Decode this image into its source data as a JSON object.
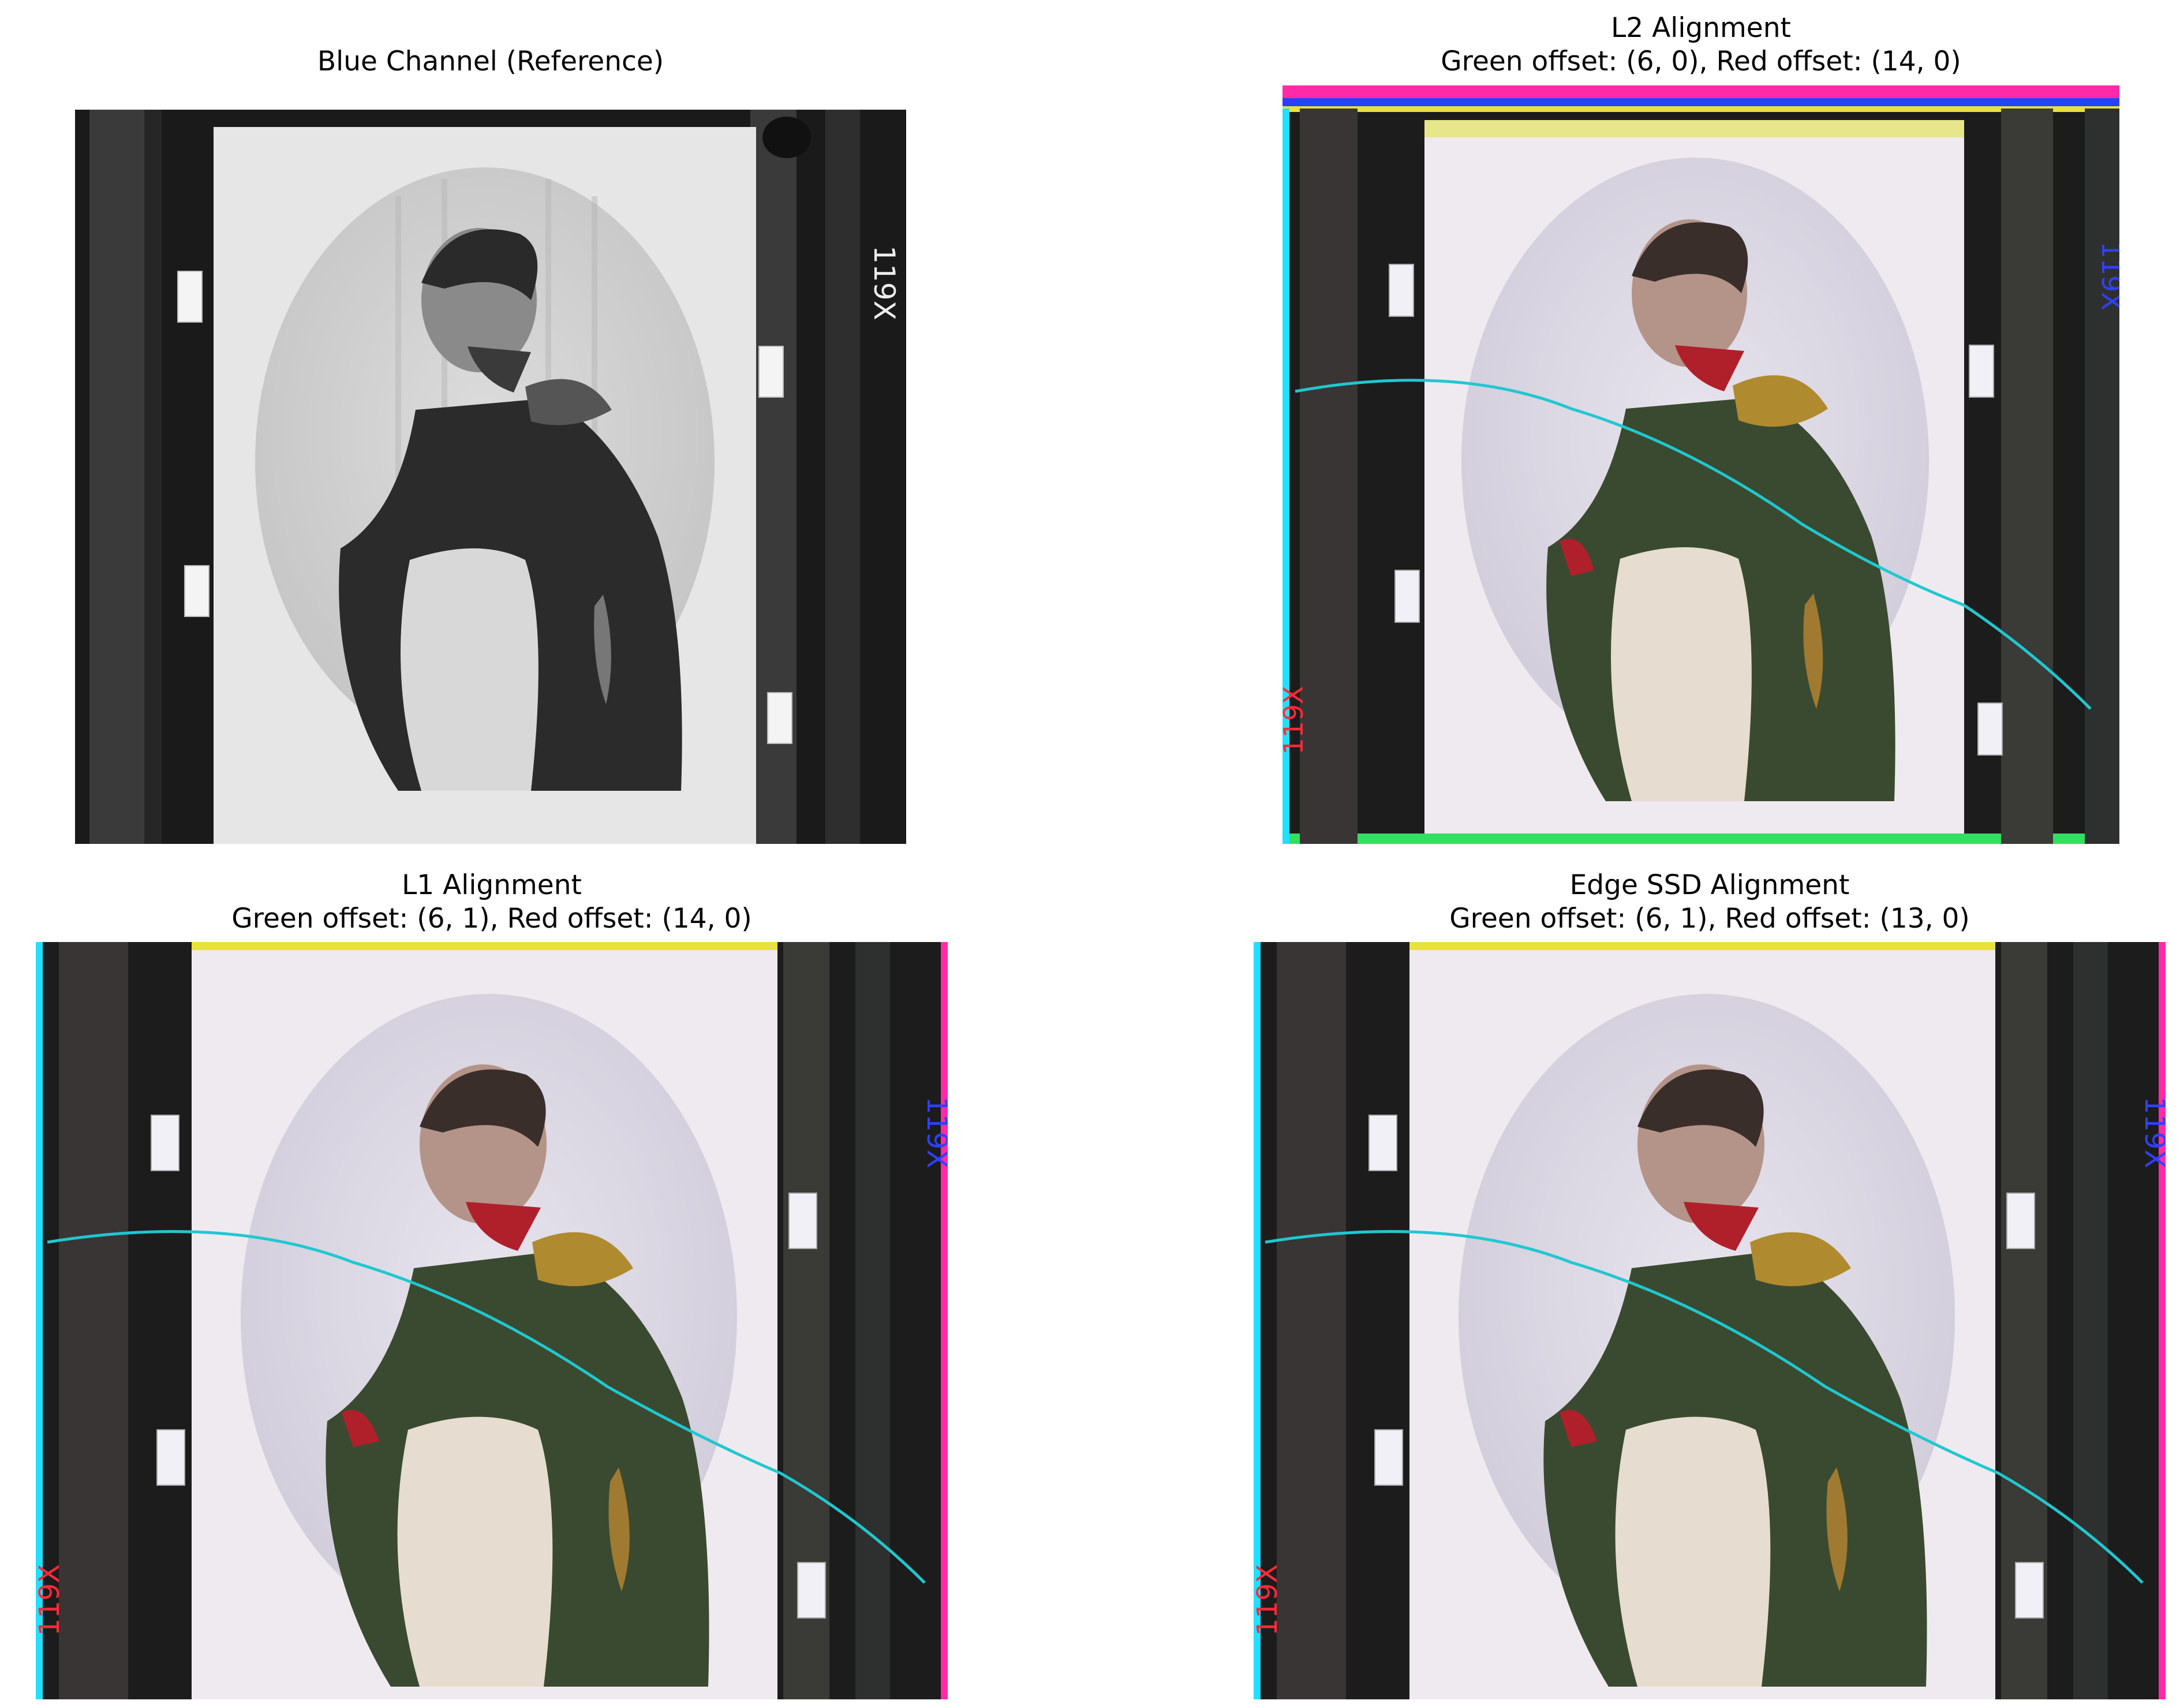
{
  "figure": {
    "panels": [
      {
        "id": "reference",
        "title": "Blue Channel (Reference)",
        "subtitle": "",
        "image_kind": "grayscale glass-plate negative of a portrait in profile"
      },
      {
        "id": "l2",
        "title": "L2 Alignment",
        "subtitle": "Green offset: (6, 0), Red offset: (14, 0)",
        "image_kind": "color composite portrait"
      },
      {
        "id": "l1",
        "title": "L1 Alignment",
        "subtitle": "Green offset: (6, 1), Red offset: (14, 0)",
        "image_kind": "color composite portrait"
      },
      {
        "id": "edge",
        "title": "Edge SSD Alignment",
        "subtitle": "Green offset: (6, 1), Red offset: (13, 0)",
        "image_kind": "color composite portrait"
      }
    ],
    "plate_label": "119X",
    "colors": {
      "background": "#ffffff",
      "film_dark": "#1c1c1c",
      "coat_green": "#3a4a30",
      "collar_red": "#b0202a",
      "epaulette_gold": "#b08a2e",
      "scratch_cyan": "#1fc8d0",
      "fringe_magenta": "#ff2aa8",
      "fringe_cyan": "#20e0ff",
      "fringe_yellow": "#e8e040"
    }
  }
}
